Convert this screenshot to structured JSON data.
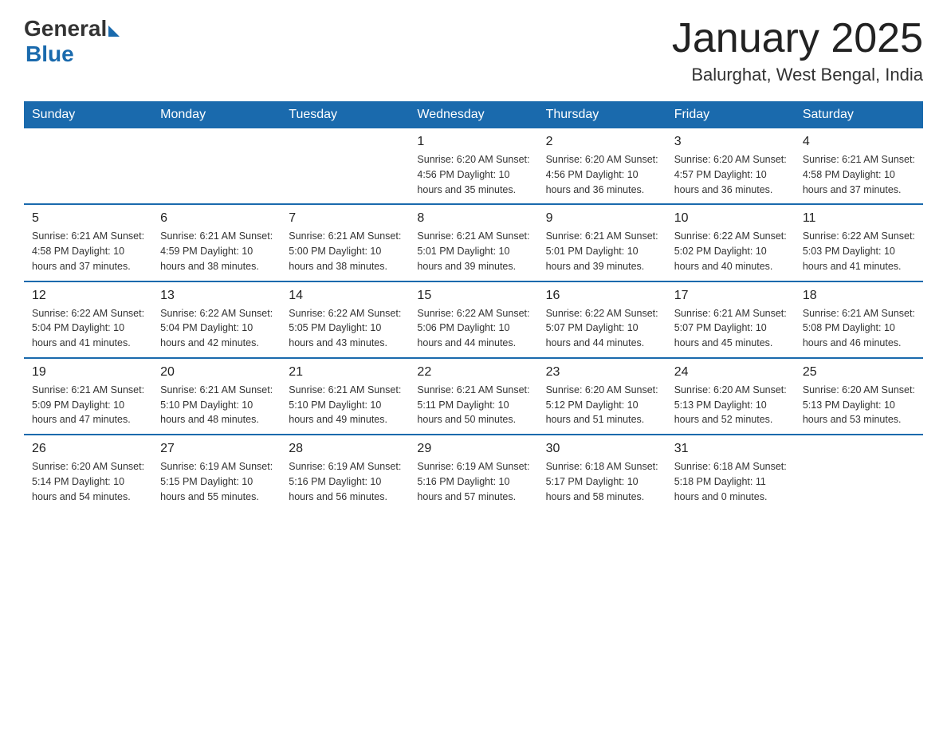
{
  "header": {
    "logo_general": "General",
    "logo_blue": "Blue",
    "month_title": "January 2025",
    "location": "Balurghat, West Bengal, India"
  },
  "days_of_week": [
    "Sunday",
    "Monday",
    "Tuesday",
    "Wednesday",
    "Thursday",
    "Friday",
    "Saturday"
  ],
  "weeks": [
    [
      {
        "day": "",
        "info": ""
      },
      {
        "day": "",
        "info": ""
      },
      {
        "day": "",
        "info": ""
      },
      {
        "day": "1",
        "info": "Sunrise: 6:20 AM\nSunset: 4:56 PM\nDaylight: 10 hours\nand 35 minutes."
      },
      {
        "day": "2",
        "info": "Sunrise: 6:20 AM\nSunset: 4:56 PM\nDaylight: 10 hours\nand 36 minutes."
      },
      {
        "day": "3",
        "info": "Sunrise: 6:20 AM\nSunset: 4:57 PM\nDaylight: 10 hours\nand 36 minutes."
      },
      {
        "day": "4",
        "info": "Sunrise: 6:21 AM\nSunset: 4:58 PM\nDaylight: 10 hours\nand 37 minutes."
      }
    ],
    [
      {
        "day": "5",
        "info": "Sunrise: 6:21 AM\nSunset: 4:58 PM\nDaylight: 10 hours\nand 37 minutes."
      },
      {
        "day": "6",
        "info": "Sunrise: 6:21 AM\nSunset: 4:59 PM\nDaylight: 10 hours\nand 38 minutes."
      },
      {
        "day": "7",
        "info": "Sunrise: 6:21 AM\nSunset: 5:00 PM\nDaylight: 10 hours\nand 38 minutes."
      },
      {
        "day": "8",
        "info": "Sunrise: 6:21 AM\nSunset: 5:01 PM\nDaylight: 10 hours\nand 39 minutes."
      },
      {
        "day": "9",
        "info": "Sunrise: 6:21 AM\nSunset: 5:01 PM\nDaylight: 10 hours\nand 39 minutes."
      },
      {
        "day": "10",
        "info": "Sunrise: 6:22 AM\nSunset: 5:02 PM\nDaylight: 10 hours\nand 40 minutes."
      },
      {
        "day": "11",
        "info": "Sunrise: 6:22 AM\nSunset: 5:03 PM\nDaylight: 10 hours\nand 41 minutes."
      }
    ],
    [
      {
        "day": "12",
        "info": "Sunrise: 6:22 AM\nSunset: 5:04 PM\nDaylight: 10 hours\nand 41 minutes."
      },
      {
        "day": "13",
        "info": "Sunrise: 6:22 AM\nSunset: 5:04 PM\nDaylight: 10 hours\nand 42 minutes."
      },
      {
        "day": "14",
        "info": "Sunrise: 6:22 AM\nSunset: 5:05 PM\nDaylight: 10 hours\nand 43 minutes."
      },
      {
        "day": "15",
        "info": "Sunrise: 6:22 AM\nSunset: 5:06 PM\nDaylight: 10 hours\nand 44 minutes."
      },
      {
        "day": "16",
        "info": "Sunrise: 6:22 AM\nSunset: 5:07 PM\nDaylight: 10 hours\nand 44 minutes."
      },
      {
        "day": "17",
        "info": "Sunrise: 6:21 AM\nSunset: 5:07 PM\nDaylight: 10 hours\nand 45 minutes."
      },
      {
        "day": "18",
        "info": "Sunrise: 6:21 AM\nSunset: 5:08 PM\nDaylight: 10 hours\nand 46 minutes."
      }
    ],
    [
      {
        "day": "19",
        "info": "Sunrise: 6:21 AM\nSunset: 5:09 PM\nDaylight: 10 hours\nand 47 minutes."
      },
      {
        "day": "20",
        "info": "Sunrise: 6:21 AM\nSunset: 5:10 PM\nDaylight: 10 hours\nand 48 minutes."
      },
      {
        "day": "21",
        "info": "Sunrise: 6:21 AM\nSunset: 5:10 PM\nDaylight: 10 hours\nand 49 minutes."
      },
      {
        "day": "22",
        "info": "Sunrise: 6:21 AM\nSunset: 5:11 PM\nDaylight: 10 hours\nand 50 minutes."
      },
      {
        "day": "23",
        "info": "Sunrise: 6:20 AM\nSunset: 5:12 PM\nDaylight: 10 hours\nand 51 minutes."
      },
      {
        "day": "24",
        "info": "Sunrise: 6:20 AM\nSunset: 5:13 PM\nDaylight: 10 hours\nand 52 minutes."
      },
      {
        "day": "25",
        "info": "Sunrise: 6:20 AM\nSunset: 5:13 PM\nDaylight: 10 hours\nand 53 minutes."
      }
    ],
    [
      {
        "day": "26",
        "info": "Sunrise: 6:20 AM\nSunset: 5:14 PM\nDaylight: 10 hours\nand 54 minutes."
      },
      {
        "day": "27",
        "info": "Sunrise: 6:19 AM\nSunset: 5:15 PM\nDaylight: 10 hours\nand 55 minutes."
      },
      {
        "day": "28",
        "info": "Sunrise: 6:19 AM\nSunset: 5:16 PM\nDaylight: 10 hours\nand 56 minutes."
      },
      {
        "day": "29",
        "info": "Sunrise: 6:19 AM\nSunset: 5:16 PM\nDaylight: 10 hours\nand 57 minutes."
      },
      {
        "day": "30",
        "info": "Sunrise: 6:18 AM\nSunset: 5:17 PM\nDaylight: 10 hours\nand 58 minutes."
      },
      {
        "day": "31",
        "info": "Sunrise: 6:18 AM\nSunset: 5:18 PM\nDaylight: 11 hours\nand 0 minutes."
      },
      {
        "day": "",
        "info": ""
      }
    ]
  ]
}
